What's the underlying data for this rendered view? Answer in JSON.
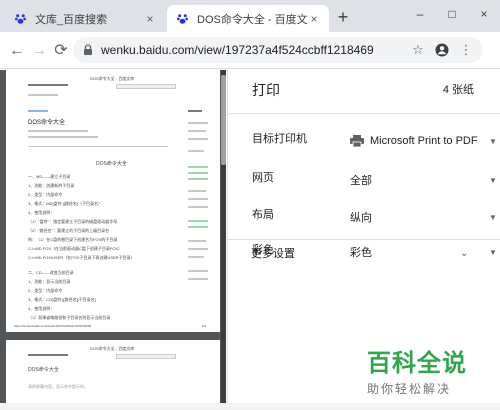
{
  "browser": {
    "tabs": [
      {
        "title": "文库_百度搜索",
        "close": "×"
      },
      {
        "title": "DOS命令大全 - 百度文库",
        "close": "×"
      }
    ],
    "new_tab": "+",
    "window_controls": {
      "minimize": "–",
      "maximize": "□",
      "close": "×"
    },
    "url": "wenku.baidu.com/view/197237a4f524ccbff1218469",
    "nav": {
      "back": "←",
      "forward": "→",
      "reload": "⟳"
    }
  },
  "preview": {
    "doc_header": "DOS命令大全 - 百度文库",
    "doc_title": "DOS命令大全",
    "body_heading": "DOS命令大全",
    "lines": [
      "一、MD——建立子目录",
      "1、功能：创建新的子目录",
      "2、类型：内部命令",
      "3、格式：MD[盘符:][路径名]〈子目录名〉",
      "4、使用说明：",
      "（1）\"盘符\"：指定要建立子目录的磁盘驱动器字母",
      "（2）\"路径名\"：要建立的子目录的上级目录名",
      "例：（1）在C盘的根目录下创建名为FOX的子目录",
      "C:\\>MD FOX（在当前驱动器C盘下创建子目录FOX）",
      "C:\\>MD FOX\\USER（在FOX子目录下再创建USER子目录）",
      "二、CD——改变当前目录",
      "1、功能：显示当前目录",
      "2、类型：内部命令",
      "3、格式：CD[盘符:][路径名][子目录名]",
      "4、使用说明：",
      "（1）如果省略路径和子目录名则显示当前目录"
    ],
    "footer_url": "https://wenku.baidu.com/view/197237a4f524ccbff1218469",
    "page_num": "1/3",
    "page2_header": "DOS命令大全 - 百度文库",
    "page2_title": "DOS命令大全",
    "page2_line": "清除屏幕内容，显示命令提示符。"
  },
  "print": {
    "title": "打印",
    "sheet_count": "4 张纸",
    "destination_label": "目标打印机",
    "destination_value": "Microsoft Print to PDF",
    "pages_label": "网页",
    "pages_value": "全部",
    "layout_label": "布局",
    "layout_value": "纵向",
    "color_label": "彩色",
    "color_value": "彩色",
    "more_settings": "更多设置"
  },
  "watermark": {
    "main": "百科全说",
    "sub": "助你轻松解决"
  }
}
